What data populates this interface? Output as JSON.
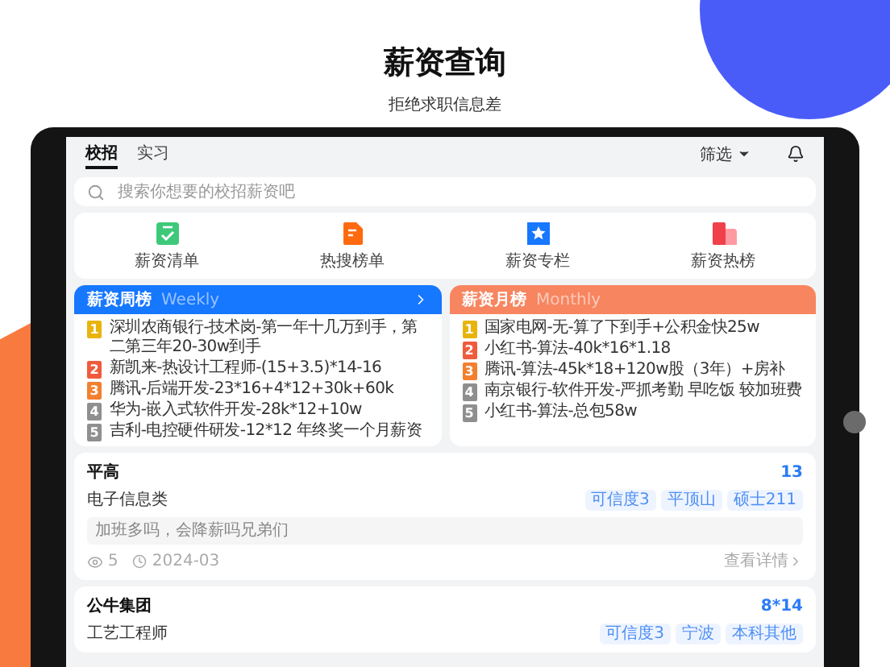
{
  "header": {
    "title": "薪资查询",
    "subtitle": "拒绝求职信息差"
  },
  "tabs": [
    {
      "label": "校招",
      "selected": true
    },
    {
      "label": "实习",
      "selected": false
    }
  ],
  "filter": {
    "label": "筛选"
  },
  "search": {
    "placeholder": "搜索你想要的校招薪资吧"
  },
  "shortcuts": [
    {
      "label": "薪资清单",
      "kind": "checklist"
    },
    {
      "label": "热搜榜单",
      "kind": "document"
    },
    {
      "label": "薪资专栏",
      "kind": "star"
    },
    {
      "label": "薪资热榜",
      "kind": "book"
    }
  ],
  "rankings": [
    {
      "title": "薪资周榜",
      "subtitle": "Weekly",
      "kind": "weekly",
      "items": [
        {
          "rank": "1",
          "text": "深圳农商银行-技术岗-第一年十几万到手，第二第三年20-30w到手"
        },
        {
          "rank": "2",
          "text": "新凯来-热设计工程师-(15+3.5)*14-16"
        },
        {
          "rank": "3",
          "text": "腾讯-后端开发-23*16+4*12+30k+60k"
        },
        {
          "rank": "4",
          "text": "华为-嵌入式软件开发-28k*12+10w"
        },
        {
          "rank": "5",
          "text": "吉利-电控硬件研发-12*12 年终奖一个月薪资"
        }
      ]
    },
    {
      "title": "薪资月榜",
      "subtitle": "Monthly",
      "kind": "monthly",
      "items": [
        {
          "rank": "1",
          "text": "国家电网-无-算了下到手+公积金快25w"
        },
        {
          "rank": "2",
          "text": "小红书-算法-40k*16*1.18"
        },
        {
          "rank": "3",
          "text": "腾讯-算法-45k*18+120w股（3年）+房补"
        },
        {
          "rank": "4",
          "text": "南京银行-软件开发-严抓考勤 早吃饭 较加班费"
        },
        {
          "rank": "5",
          "text": "小红书-算法-总包58w"
        }
      ]
    }
  ],
  "posts": [
    {
      "company": "平高",
      "salary": "13",
      "position": "电子信息类",
      "tags": [
        "可信度3",
        "平顶山",
        "硕士211"
      ],
      "comment": "加班多吗，会降薪吗兄弟们",
      "views": "5",
      "date": "2024-03",
      "link": "查看详情"
    },
    {
      "company": "公牛集团",
      "salary": "8*14",
      "position": "工艺工程师",
      "tags": [
        "可信度3",
        "宁波",
        "本科其他"
      ]
    }
  ]
}
